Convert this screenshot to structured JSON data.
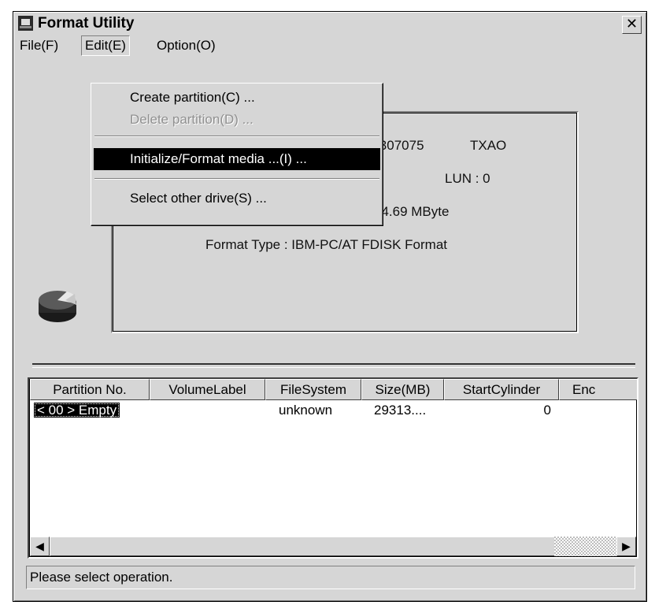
{
  "window": {
    "title": "Format Utility",
    "close_glyph": "✕"
  },
  "menubar": {
    "file": "File(F)",
    "edit": "Edit(E)",
    "option": "Option(O)"
  },
  "edit_menu": {
    "create": "Create partition(C) ...",
    "delete": "Delete partition(D) ...",
    "initialize": "Initialize/Format media ...(I) ...",
    "select_drive": "Select other drive(S) ..."
  },
  "info": {
    "model": "A–307075",
    "vendor": "TXAO",
    "id": ": 0",
    "lun": "LUN : 0",
    "capacity": "14.69 MByte",
    "format_type": "Format Type : IBM-PC/AT FDISK Format"
  },
  "table": {
    "columns": [
      "Partition No.",
      "VolumeLabel",
      "FileSystem",
      "Size(MB)",
      "StartCylinder",
      "Enc"
    ],
    "rows": [
      {
        "partition": "< 00 > Empty",
        "volume": "",
        "fs": "unknown",
        "size": "29313....",
        "start": "0"
      }
    ]
  },
  "status": "Please select operation.",
  "icons": {
    "app": "format-utility-icon",
    "disk": "pie-disk-icon"
  }
}
